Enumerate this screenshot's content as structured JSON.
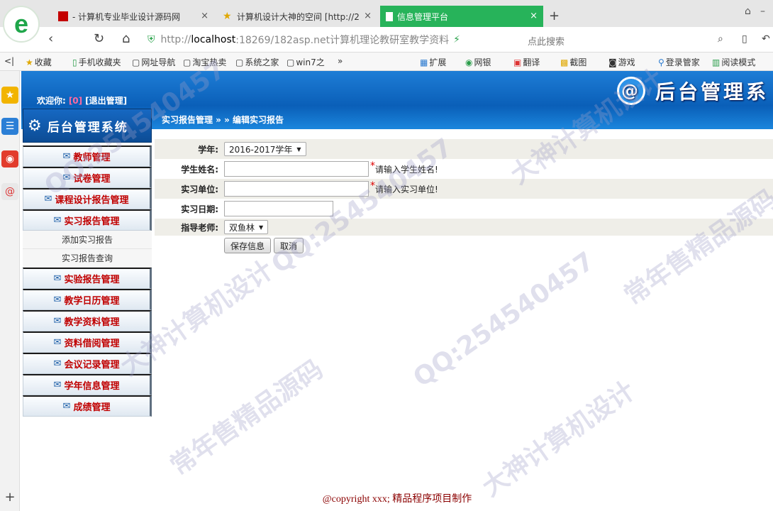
{
  "browser": {
    "tabs": [
      {
        "label": "- 计算机专业毕业设计源码网",
        "close": "×"
      },
      {
        "label": "计算机设计大神的空间 [http://2",
        "close": "×"
      },
      {
        "label": "信息管理平台",
        "close": "×"
      }
    ],
    "newtab": "+",
    "address": {
      "prefix": "http://",
      "host": "localhost",
      "rest": ":18269/182asp.net计算机理论教研室教学资料"
    },
    "search_hint": "点此搜索",
    "bookmarks": [
      "收藏",
      "手机收藏夹",
      "网址导航",
      "淘宝热卖",
      "系统之家",
      "win7之",
      "扩展",
      "网银",
      "翻译",
      "截图",
      "游戏",
      "登录管家",
      "阅读模式"
    ]
  },
  "header": {
    "welcome_label": "欢迎你:",
    "username": "[0]",
    "logout": "[退出管理]",
    "big_title": "后台管理系",
    "breadcrumb": "实习报告管理 » » 编辑实习报告"
  },
  "sidebar": {
    "title": "后台管理系统",
    "items": [
      {
        "label": "教师管理"
      },
      {
        "label": "试卷管理"
      },
      {
        "label": "课程设计报告管理"
      },
      {
        "label": "实习报告管理",
        "sub": [
          "添加实习报告",
          "实习报告查询"
        ]
      },
      {
        "label": "实验报告管理"
      },
      {
        "label": "教学日历管理"
      },
      {
        "label": "教学资料管理"
      },
      {
        "label": "资料借阅管理"
      },
      {
        "label": "会议记录管理"
      },
      {
        "label": "学年信息管理"
      },
      {
        "label": "成绩管理"
      }
    ]
  },
  "form": {
    "year_label": "学年:",
    "year_value": "2016-2017学年",
    "name_label": "学生姓名:",
    "name_value": "",
    "name_hint": "请输入学生姓名!",
    "unit_label": "实习单位:",
    "unit_value": "",
    "unit_hint": "请输入实习单位!",
    "date_label": "实习日期:",
    "date_value": "",
    "teacher_label": "指导老师:",
    "teacher_value": "双鱼林",
    "save": "保存信息",
    "cancel": "取消",
    "required_mark": "*"
  },
  "footer": "@copyright xxx; 精品程序项目制作",
  "watermark": [
    "QQ:254540457",
    "大神计算机设计",
    "常年售精品源码"
  ],
  "colors": {
    "header_blue": "#0a5fb8",
    "menu_text": "#c00000",
    "active_tab": "#27b35a",
    "footer": "#8b0000"
  }
}
